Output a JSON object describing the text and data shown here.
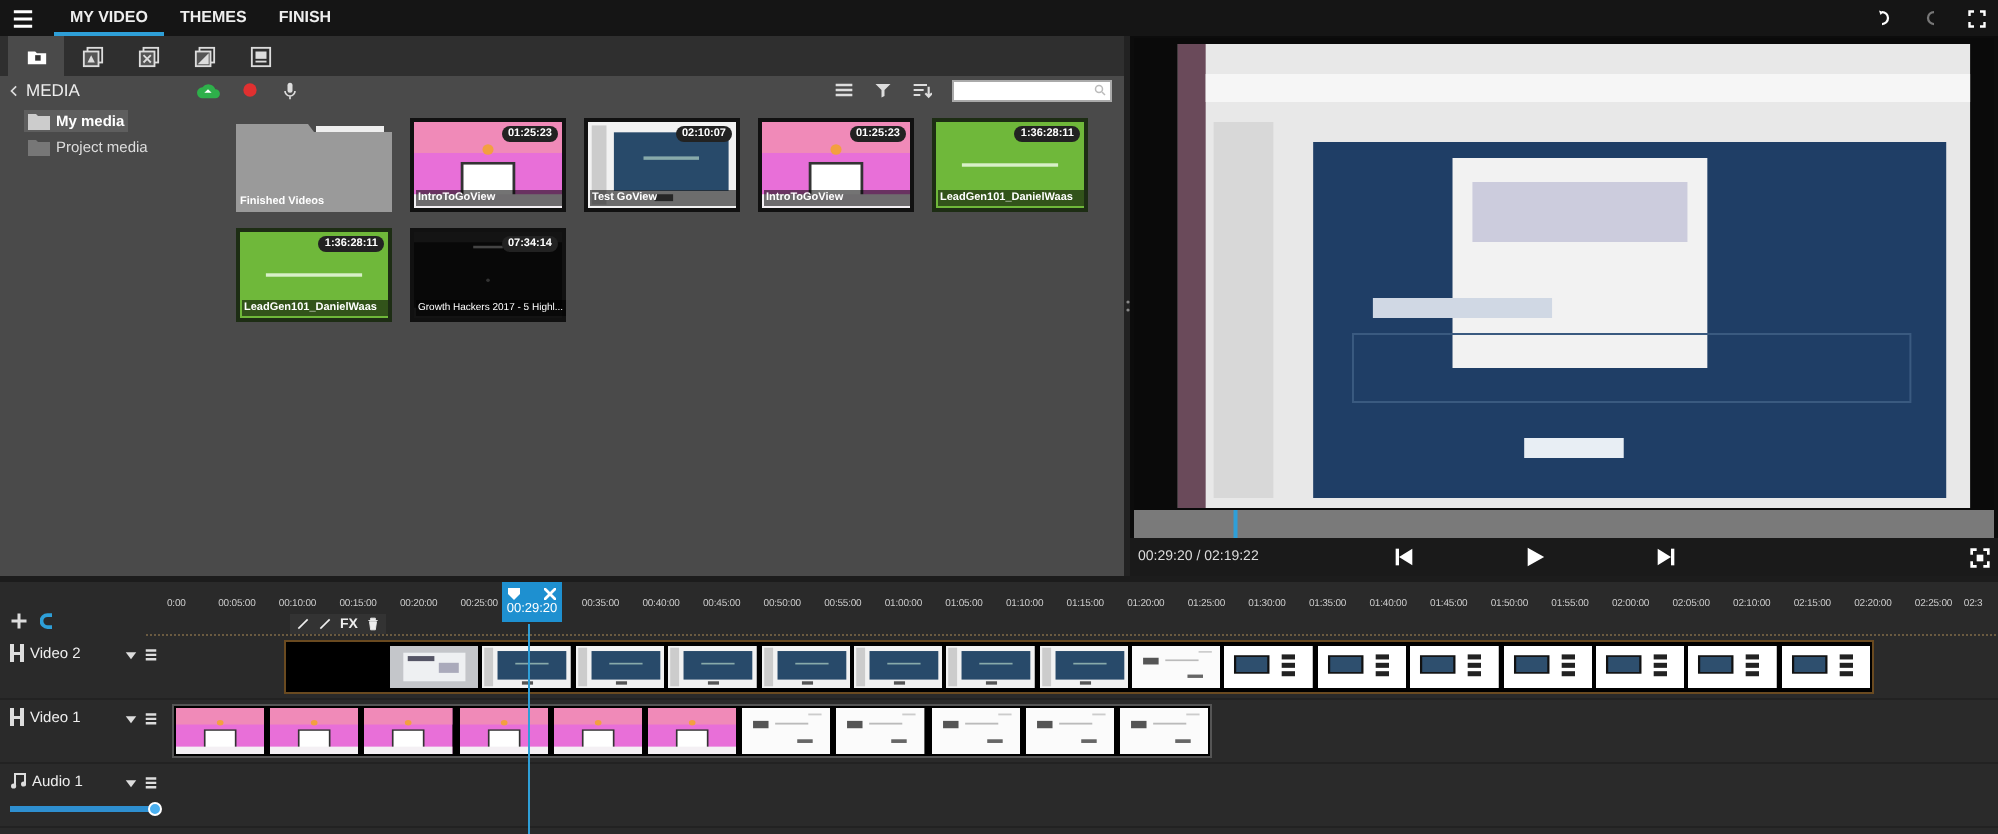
{
  "menu": {
    "tabs": [
      {
        "label": "MY VIDEO",
        "selected": true
      },
      {
        "label": "THEMES",
        "selected": false
      },
      {
        "label": "FINISH",
        "selected": false
      }
    ]
  },
  "toolbar": {
    "tools": [
      {
        "selected": true
      },
      {
        "selected": false
      },
      {
        "selected": false
      },
      {
        "selected": false
      },
      {
        "selected": false
      }
    ]
  },
  "media": {
    "title": "MEDIA",
    "sidebar": [
      {
        "label": "My media",
        "selected": true
      },
      {
        "label": "Project media",
        "selected": false
      }
    ],
    "items": [
      {
        "kind": "folder",
        "label": "Finished Videos"
      },
      {
        "kind": "video",
        "label": "IntroToGoView",
        "duration": "01:25:23"
      },
      {
        "kind": "video",
        "label": "Test GoView",
        "duration": "02:10:07"
      },
      {
        "kind": "video",
        "label": "IntroToGoView",
        "duration": "01:25:23"
      },
      {
        "kind": "video",
        "label": "LeadGen101_DanielWaas",
        "duration": "1:36:28:11"
      },
      {
        "kind": "video",
        "label": "LeadGen101_DanielWaas",
        "duration": "1:36:28:11"
      },
      {
        "kind": "video",
        "label": "Growth Hackers 2017 - 5 Highl...",
        "duration": "07:34:14"
      }
    ]
  },
  "preview": {
    "time": "00:29:20 / 02:19:22"
  },
  "timeline": {
    "ruler_before_playhead": [
      "0:00",
      "00:05:00",
      "00:10:00",
      "00:15:00",
      "00:20:00",
      "00:25:00"
    ],
    "ruler_after_playhead": [
      "00:35:00",
      "00:40:00",
      "00:45:00",
      "00:50:00",
      "00:55:00",
      "01:00:00",
      "01:05:00",
      "01:10:00",
      "01:15:00",
      "01:20:00",
      "01:25:00",
      "01:30:00",
      "01:35:00",
      "01:40:00",
      "01:45:00",
      "01:50:00",
      "01:55:00",
      "02:00:00",
      "02:05:00",
      "02:10:00",
      "02:15:00",
      "02:20:00",
      "02:25:00",
      "02:3"
    ],
    "playhead": "00:29:20",
    "clip_tool": "FX",
    "tracks": [
      {
        "kind": "video",
        "name": "Video 2"
      },
      {
        "kind": "video",
        "name": "Video 1"
      },
      {
        "kind": "audio",
        "name": "Audio 1",
        "level": 1
      }
    ]
  }
}
